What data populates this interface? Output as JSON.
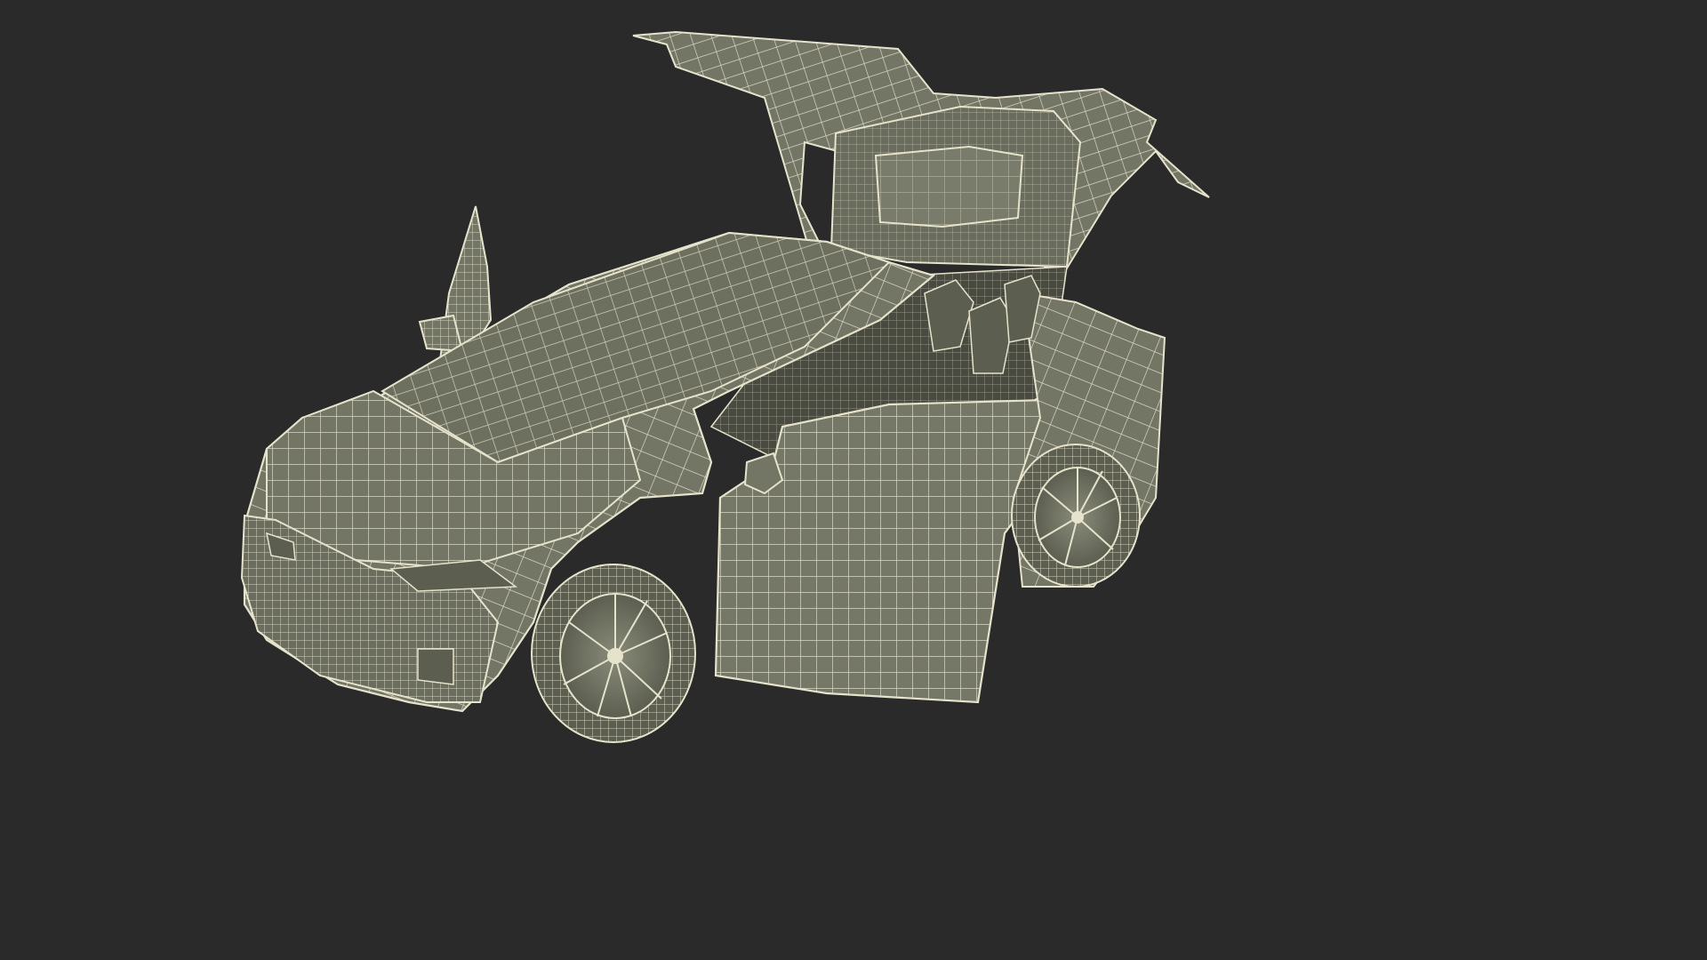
{
  "scene": {
    "subject": "wireframe-render-of-suv-with-open-falcon-wing-doors",
    "colors": {
      "background": "#2a2a2a",
      "surface": "#737565",
      "surface_dark": "#5c5e50",
      "surface_light": "#8a8c7a",
      "wire": "#e6e3cc",
      "interior": "#4a4b40"
    }
  }
}
